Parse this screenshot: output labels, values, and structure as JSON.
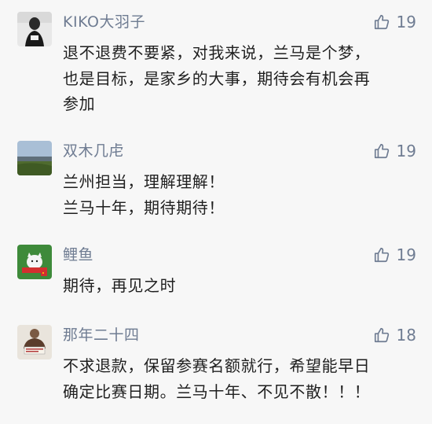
{
  "comments": [
    {
      "user": "KIKO大羽子",
      "likes": "19",
      "text": "退不退费不要紧，对我来说，兰马是个梦，\n也是目标，是家乡的大事，期待会有机会再\n参加",
      "avatar": "person-dark-photo"
    },
    {
      "user": "双木几虍",
      "likes": "19",
      "text": "兰州担当，理解理解！\n兰马十年，期待期待！",
      "avatar": "landscape-photo"
    },
    {
      "user": "鲤鱼",
      "likes": "19",
      "text": "期待，再见之时",
      "avatar": "cat-flag-photo"
    },
    {
      "user": "那年二十四",
      "likes": "18",
      "text": "不求退款，保留参赛名额就行，希望能早日\n确定比赛日期。兰马十年、不见不散！！！",
      "avatar": "person-sign-photo"
    }
  ],
  "colors": {
    "name": "#6f7c92",
    "text": "#1f1f1f",
    "background": "#f7f7f7"
  },
  "icons": {
    "like": "thumbs-up-icon"
  }
}
